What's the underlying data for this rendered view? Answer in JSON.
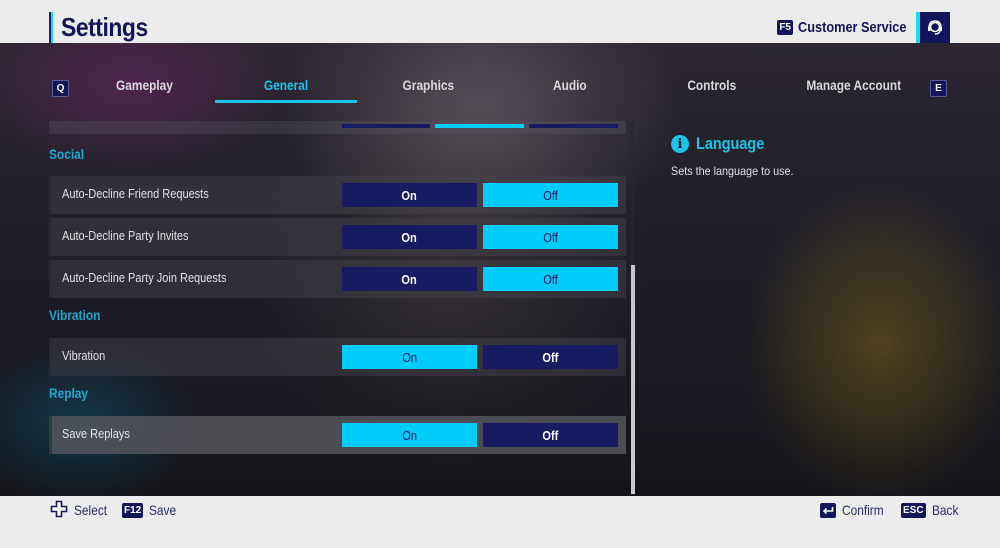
{
  "header": {
    "title": "Settings",
    "customer_service": {
      "key": "F5",
      "label": "Customer Service",
      "icon": "headset-icon"
    }
  },
  "tabs": {
    "prev_key": "Q",
    "next_key": "E",
    "items": [
      {
        "label": "Gameplay",
        "active": false
      },
      {
        "label": "General",
        "active": true
      },
      {
        "label": "Graphics",
        "active": false
      },
      {
        "label": "Audio",
        "active": false
      },
      {
        "label": "Controls",
        "active": false
      },
      {
        "label": "Manage Account",
        "active": false
      }
    ]
  },
  "settings": {
    "partial_row": {
      "selected_index": 1,
      "options_count": 3
    },
    "sections": [
      {
        "title": "Social",
        "rows": [
          {
            "label": "Auto-Decline Friend Requests",
            "on_label": "On",
            "off_label": "Off",
            "value": "Off"
          },
          {
            "label": "Auto-Decline Party Invites",
            "on_label": "On",
            "off_label": "Off",
            "value": "Off"
          },
          {
            "label": "Auto-Decline Party Join Requests",
            "on_label": "On",
            "off_label": "Off",
            "value": "Off"
          }
        ]
      },
      {
        "title": "Vibration",
        "rows": [
          {
            "label": "Vibration",
            "on_label": "On",
            "off_label": "Off",
            "value": "On"
          }
        ]
      },
      {
        "title": "Replay",
        "rows": [
          {
            "label": "Save Replays",
            "on_label": "On",
            "off_label": "Off",
            "value": "On",
            "focused": true
          }
        ]
      }
    ]
  },
  "info_panel": {
    "icon": "info-icon",
    "title": "Language",
    "description": "Sets the language to use."
  },
  "footer": {
    "left": [
      {
        "icon": "dpad-icon",
        "label": "Select"
      },
      {
        "key": "F12",
        "label": "Save"
      }
    ],
    "right": [
      {
        "key": "enter-icon",
        "label": "Confirm"
      },
      {
        "key": "ESC",
        "label": "Back"
      }
    ]
  },
  "colors": {
    "accent": "#1bc4e8",
    "selected_option": "#00ccfa",
    "unselected_option": "#181a62",
    "navy": "#121559",
    "section_title": "#1aa9d0"
  }
}
